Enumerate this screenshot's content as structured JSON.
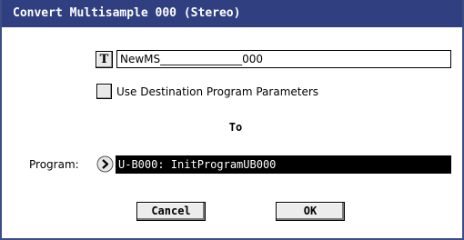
{
  "dialog": {
    "title": "Convert Multisample 000 (Stereo)"
  },
  "name": {
    "text_edit_button_label": "T",
    "value": "NewMS_______________000"
  },
  "options": {
    "use_dest_params_label": "Use Destination Program Parameters",
    "use_dest_params_checked": false
  },
  "destination": {
    "to_label": "To",
    "program_label": "Program:",
    "program_value": "U-B000: InitProgramUB000"
  },
  "buttons": {
    "cancel_label": "Cancel",
    "ok_label": "OK"
  },
  "colors": {
    "title_bar": "#2f3f80",
    "selected_field": "#000000"
  }
}
